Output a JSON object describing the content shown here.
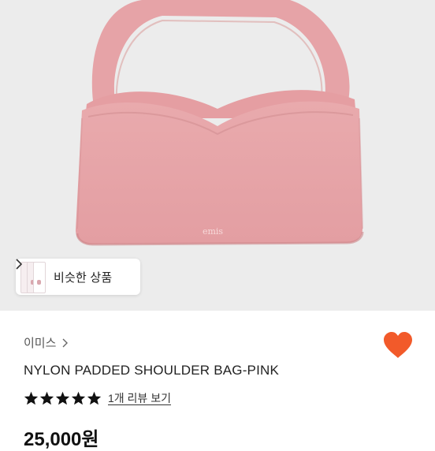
{
  "product_image": {
    "brand_mark": "emis",
    "bag_color": "#e8a5a8"
  },
  "similar_products_button": {
    "label": "비슷한 상품"
  },
  "product": {
    "brand": "이미스",
    "title": "NYLON PADDED SHOULDER BAG-PINK",
    "rating": 5,
    "review_link": "1개 리뷰 보기",
    "price_partial": "25,000원"
  },
  "colors": {
    "heart": "#f25a2a",
    "hero_background": "#ececec"
  },
  "icons": {
    "brand_chevron": "chevron-right-icon",
    "similar_chevron": "chevron-right-icon",
    "favorite": "heart-icon",
    "star": "star-icon"
  }
}
